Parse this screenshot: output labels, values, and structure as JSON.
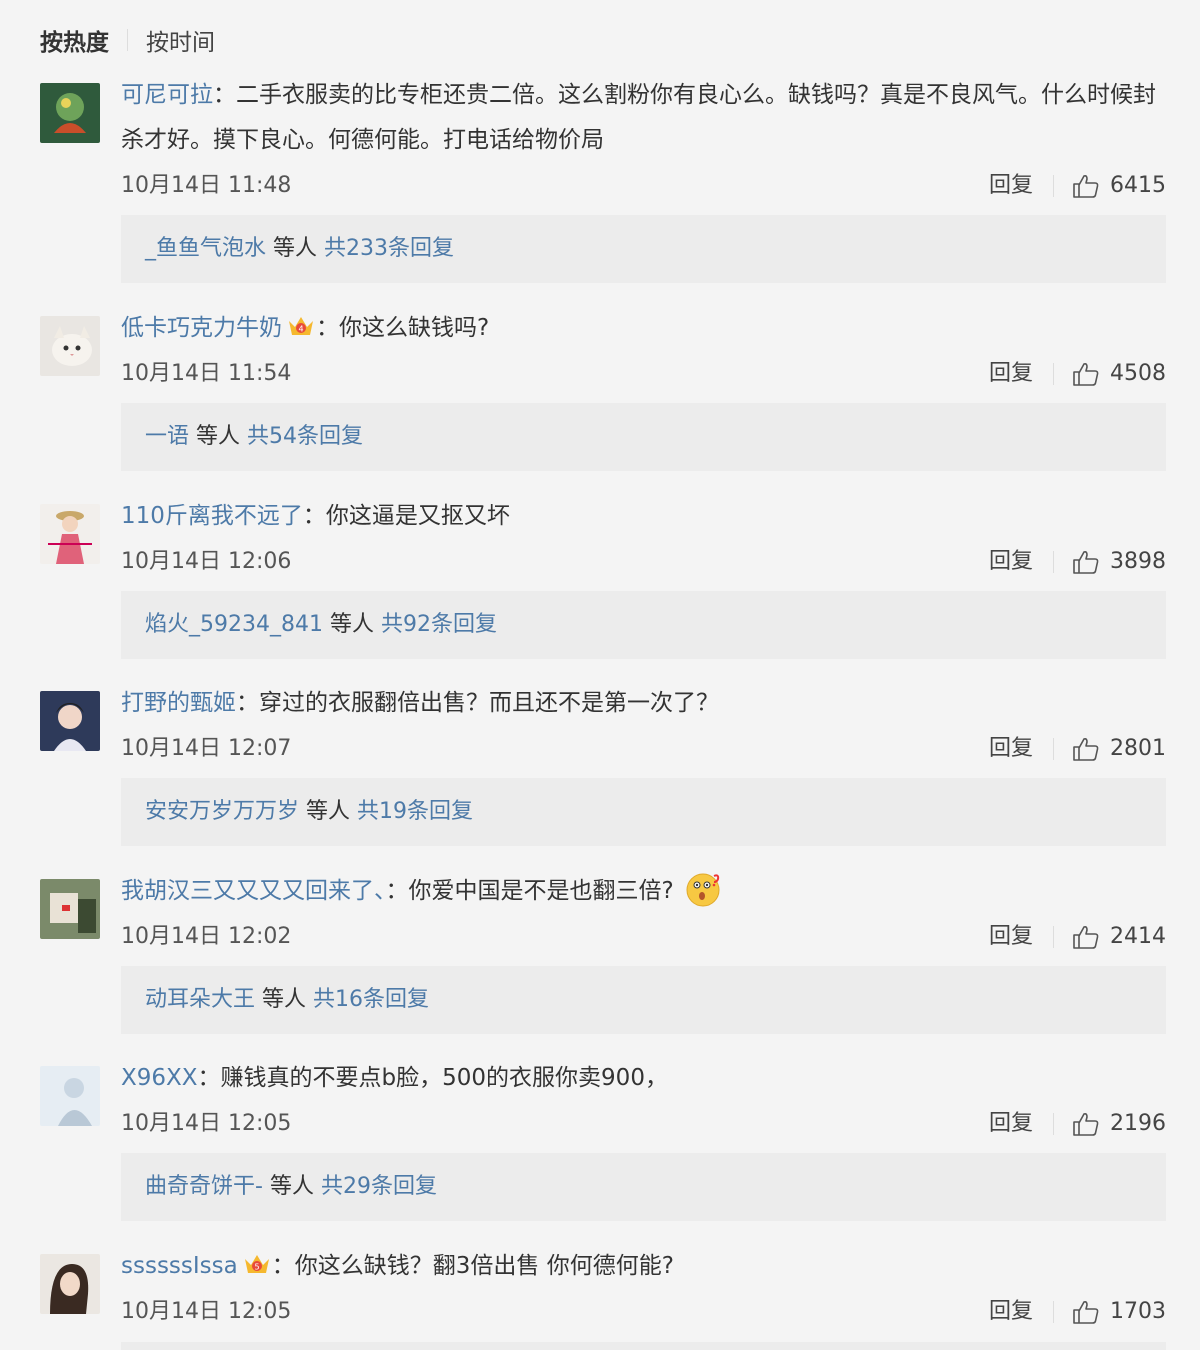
{
  "sort": {
    "hot_label": "按热度",
    "time_label": "按时间"
  },
  "comments": [
    {
      "user": "可尼可拉",
      "sep": "：",
      "text": "二手衣服卖的比专柜还贵二倍。这么割粉你有良心么。缺钱吗？真是不良风气。什么时候封杀才好。摸下良心。何德何能。打电话给物价局",
      "time": "10月14日 11:48",
      "reply_label": "回复",
      "likes": "6415",
      "sub_name": "_鱼鱼气泡水",
      "sub_mid": "等人",
      "sub_count": "共233条回复"
    },
    {
      "user": "低卡巧克力牛奶",
      "sep": "：",
      "text": "你这么缺钱吗?",
      "time": "10月14日 11:54",
      "reply_label": "回复",
      "likes": "4508",
      "sub_name": "一语",
      "sub_mid": "等人",
      "sub_count": "共54条回复"
    },
    {
      "user": "110斤离我不远了",
      "sep": "：",
      "text": "你这逼是又抠又坏",
      "time": "10月14日 12:06",
      "reply_label": "回复",
      "likes": "3898",
      "sub_name": "焰火_59234_841",
      "sub_mid": "等人",
      "sub_count": "共92条回复"
    },
    {
      "user": "打野的甄姬",
      "sep": "：",
      "text": "穿过的衣服翻倍出售？而且还不是第一次了？",
      "time": "10月14日 12:07",
      "reply_label": "回复",
      "likes": "2801",
      "sub_name": "安安万岁万万岁",
      "sub_mid": "等人",
      "sub_count": "共19条回复"
    },
    {
      "user": "我胡汉三又又又又回来了、",
      "sep": "：",
      "text": "你爱中国是不是也翻三倍?",
      "time": "10月14日 12:02",
      "reply_label": "回复",
      "likes": "2414",
      "sub_name": "动耳朵大王",
      "sub_mid": "等人",
      "sub_count": "共16条回复"
    },
    {
      "user": "X96XX",
      "sep": "：",
      "text": "赚钱真的不要点b脸，500的衣服你卖900，",
      "time": "10月14日 12:05",
      "reply_label": "回复",
      "likes": "2196",
      "sub_name": "曲奇奇饼干-",
      "sub_mid": "等人",
      "sub_count": "共29条回复"
    },
    {
      "user": "ssssssIssa",
      "sep": "：",
      "text": "你这么缺钱？翻3倍出售  你何德何能?",
      "time": "10月14日 12:05",
      "reply_label": "回复",
      "likes": "1703"
    }
  ],
  "colors": {
    "link": "#4d7aa8",
    "reply_box": "#ececec",
    "background": "#f4f4f4"
  },
  "icons": {
    "like": "thumbs-up-icon",
    "badge": "crown-badge-icon",
    "emoji": "thinking-emoji-icon"
  }
}
